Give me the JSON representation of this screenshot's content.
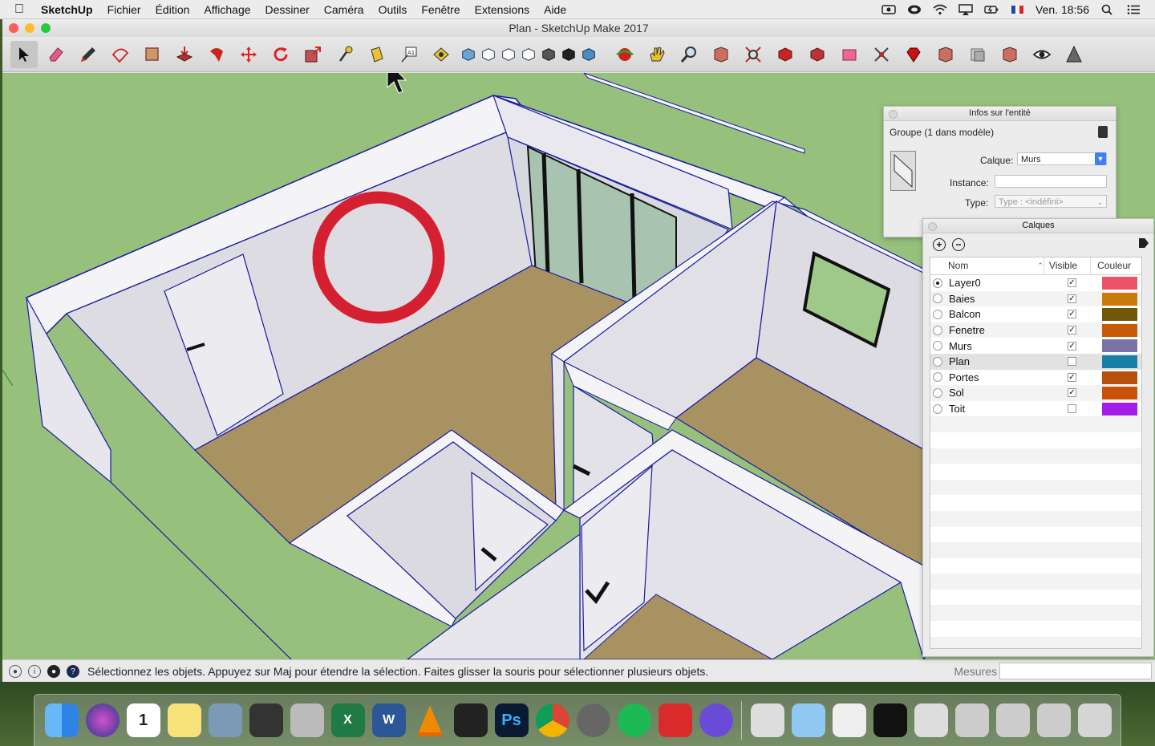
{
  "menubar": {
    "app_name": "SketchUp",
    "items": [
      "Fichier",
      "Édition",
      "Affichage",
      "Dessiner",
      "Caméra",
      "Outils",
      "Fenêtre",
      "Extensions",
      "Aide"
    ],
    "clock": "Ven. 18:56"
  },
  "window": {
    "title": "Plan - SketchUp Make 2017"
  },
  "statusbar": {
    "message": "Sélectionnez les objets. Appuyez sur Maj pour étendre la sélection. Faites glisser la souris pour sélectionner plusieurs objets.",
    "measures_label": "Mesures",
    "measures_value": ""
  },
  "entity_info": {
    "title": "Infos sur l'entité",
    "selection": "Groupe (1 dans modèle)",
    "layer_label": "Calque:",
    "layer_value": "Murs",
    "instance_label": "Instance:",
    "instance_value": "",
    "type_label": "Type:",
    "type_placeholder": "Type : <indéfini>"
  },
  "layers_panel": {
    "title": "Calques",
    "col_name": "Nom",
    "col_visible": "Visible",
    "col_color": "Couleur",
    "layers": [
      {
        "name": "Layer0",
        "active": true,
        "visible": true,
        "color": "#ee5266"
      },
      {
        "name": "Baies",
        "active": false,
        "visible": true,
        "color": "#c97a0a"
      },
      {
        "name": "Balcon",
        "active": false,
        "visible": true,
        "color": "#6e5708"
      },
      {
        "name": "Fenetre",
        "active": false,
        "visible": true,
        "color": "#c95a0a"
      },
      {
        "name": "Murs",
        "active": false,
        "visible": true,
        "color": "#7a74a6"
      },
      {
        "name": "Plan",
        "active": false,
        "visible": false,
        "color": "#1a7fa6"
      },
      {
        "name": "Portes",
        "active": false,
        "visible": true,
        "color": "#b8500c"
      },
      {
        "name": "Sol",
        "active": false,
        "visible": true,
        "color": "#c9520a"
      },
      {
        "name": "Toit",
        "active": false,
        "visible": false,
        "color": "#a21ee8"
      }
    ]
  },
  "toolbar_tools": [
    "select-tool",
    "eraser-tool",
    "pencil-tool",
    "shape-tool",
    "rectangle-tool",
    "push-pull-tool",
    "follow-me-tool",
    "move-tool",
    "rotate-tool",
    "scale-tool",
    "tape-measure-tool",
    "paint-bucket-tool",
    "text-tool",
    "component-tool"
  ],
  "dock_apps": [
    "Finder",
    "Siri",
    "Calendrier",
    "Notes",
    "Aperçu",
    "Final Cut",
    "Outils",
    "Excel",
    "Word",
    "VLC",
    "Unity",
    "Photoshop",
    "Chrome",
    "Préférences",
    "Spotify",
    "SketchUp",
    "iMovie",
    "Brushes"
  ]
}
